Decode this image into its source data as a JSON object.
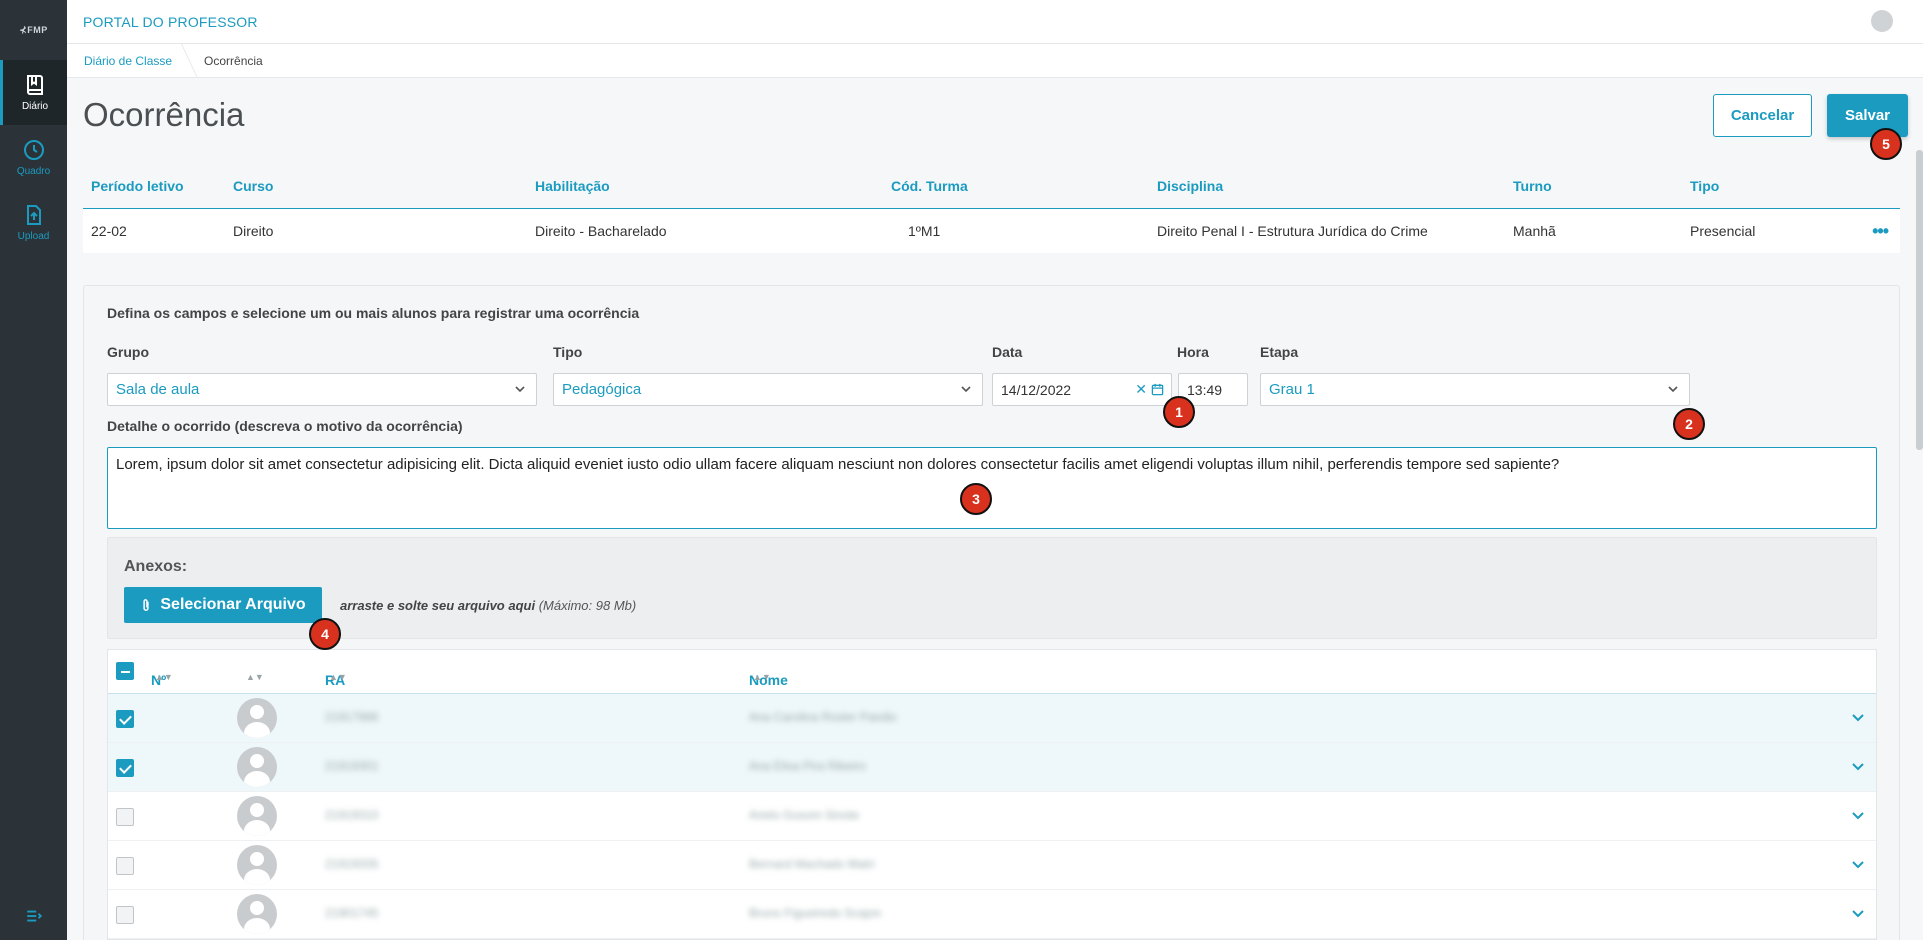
{
  "app": {
    "logo": "FMP",
    "title": "PORTAL DO PROFESSOR"
  },
  "sidebar": {
    "items": [
      {
        "label": "Diário",
        "icon": "book-icon",
        "active": true
      },
      {
        "label": "Quadro",
        "icon": "clock-icon",
        "active": false
      },
      {
        "label": "Upload",
        "icon": "upload-icon",
        "active": false
      }
    ],
    "bottom_icon": "expand-menu-icon"
  },
  "breadcrumb": {
    "parent": "Diário de Classe",
    "current": "Ocorrência"
  },
  "page": {
    "title": "Ocorrência",
    "cancel_label": "Cancelar",
    "save_label": "Salvar"
  },
  "class_info": {
    "headers": {
      "periodo": "Período letivo",
      "curso": "Curso",
      "habilitacao": "Habilitação",
      "turma": "Cód. Turma",
      "disciplina": "Disciplina",
      "turno": "Turno",
      "tipo": "Tipo"
    },
    "row": {
      "periodo": "22-02",
      "curso": "Direito",
      "habilitacao": "Direito - Bacharelado",
      "turma": "1ºM1",
      "disciplina": "Direito Penal I - Estrutura Jurídica do Crime",
      "turno": "Manhã",
      "tipo": "Presencial",
      "more": "•••"
    }
  },
  "form": {
    "intro": "Defina os campos e selecione um ou mais alunos para registrar uma ocorrência",
    "grupo": {
      "label": "Grupo",
      "value": "Sala de aula"
    },
    "tipo": {
      "label": "Tipo",
      "value": "Pedagógica"
    },
    "data": {
      "label": "Data",
      "value": "14/12/2022"
    },
    "hora": {
      "label": "Hora",
      "value": "13:49"
    },
    "etapa": {
      "label": "Etapa",
      "value": "Grau 1"
    },
    "detalhe": {
      "label": "Detalhe o ocorrido (descreva o motivo da ocorrência)",
      "value": "Lorem, ipsum dolor sit amet consectetur adipisicing elit. Dicta aliquid eveniet iusto odio ullam facere aliquam nesciunt non dolores consectetur facilis amet eligendi voluptas illum nihil, perferendis tempore sed sapiente?"
    },
    "anexos": {
      "title": "Anexos:",
      "button_label": "Selecionar Arquivo",
      "drop_text": "arraste e solte seu arquivo aqui",
      "max_text": "(Máximo: 98 Mb)"
    }
  },
  "students": {
    "headers": {
      "numero": "Nº",
      "ra": "RA",
      "nome": "Nome"
    },
    "rows": [
      {
        "selected": true,
        "ra": "21917986",
        "nome": "Ana Carolina Rosler Paixão"
      },
      {
        "selected": true,
        "ra": "21919301",
        "nome": "Ana Elisa Pira Ribeiro"
      },
      {
        "selected": false,
        "ra": "21919310",
        "nome": "Arielo Gusom Sinote"
      },
      {
        "selected": false,
        "ra": "21919335",
        "nome": "Bernard Machado Matri"
      },
      {
        "selected": false,
        "ra": "21901745",
        "nome": "Bruno Figueiredo Scajon"
      }
    ]
  },
  "markers": [
    "1",
    "2",
    "3",
    "4",
    "5"
  ],
  "colors": {
    "accent": "#1b9bc0",
    "sidebar": "#2b3338",
    "marker": "#d8321e"
  }
}
